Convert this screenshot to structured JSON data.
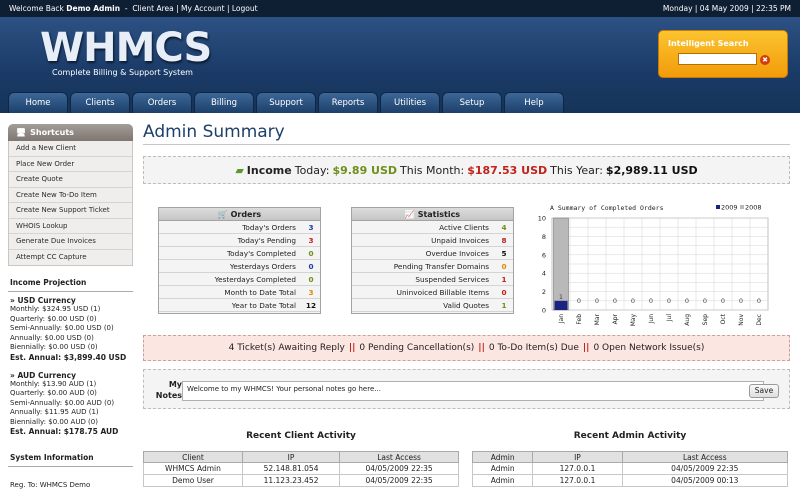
{
  "topbar": {
    "welcome_prefix": "Welcome Back",
    "user": "Demo Admin",
    "links": [
      "Client Area",
      "My Account",
      "Logout"
    ],
    "date": "Monday | 04 May 2009 | 22:35 PM"
  },
  "brand": {
    "logo": "WHMCS",
    "tagline": "Complete Billing & Support System"
  },
  "search": {
    "label": "Intelligent Search",
    "value": ""
  },
  "nav": [
    "Home",
    "Clients",
    "Orders",
    "Billing",
    "Support",
    "Reports",
    "Utilities",
    "Setup",
    "Help"
  ],
  "shortcuts": {
    "title": "Shortcuts",
    "items": [
      "Add a New Client",
      "Place New Order",
      "Create Quote",
      "Create New To-Do Item",
      "Create New Support Ticket",
      "WHOIS Lookup",
      "Generate Due Invoices",
      "Attempt CC Capture"
    ]
  },
  "income_projection": {
    "title": "Income Projection",
    "currencies": [
      {
        "name": "USD Currency",
        "lines": [
          "Monthly: $324.95 USD (1)",
          "Quarterly: $0.00 USD (0)",
          "Semi-Annually: $0.00 USD (0)",
          "Annually: $0.00 USD (0)",
          "Biennially: $0.00 USD (0)"
        ],
        "est": "Est. Annual: $3,899.40 USD"
      },
      {
        "name": "AUD Currency",
        "lines": [
          "Monthly: $13.90 AUD (1)",
          "Quarterly: $0.00 AUD (0)",
          "Semi-Annually: $0.00 AUD (0)",
          "Annually: $11.95 AUD (1)",
          "Biennially: $0.00 AUD (0)"
        ],
        "est": "Est. Annual: $178.75 AUD"
      }
    ]
  },
  "system_info": {
    "title": "System Information",
    "reg_to": "Reg. To: WHMCS Demo"
  },
  "page_title": "Admin Summary",
  "income": {
    "label": "Income",
    "today_label": "Today:",
    "today": "$9.89 USD",
    "month_label": "This Month:",
    "month": "$187.53 USD",
    "year_label": "This Year:",
    "year": "$2,989.11 USD",
    "colors": {
      "today": "#6e8f1b",
      "month": "#c0221c",
      "year": "#111111"
    }
  },
  "orders": {
    "title": "Orders",
    "rows": [
      {
        "label": "Today's Orders",
        "value": "3",
        "color": "#1f3ea0"
      },
      {
        "label": "Today's Pending",
        "value": "3",
        "color": "#c0221c"
      },
      {
        "label": "Today's Completed",
        "value": "0",
        "color": "#6e8f1b"
      },
      {
        "label": "Yesterdays Orders",
        "value": "0",
        "color": "#1f3ea0"
      },
      {
        "label": "Yesterdays Completed",
        "value": "0",
        "color": "#6e8f1b"
      },
      {
        "label": "Month to Date Total",
        "value": "3",
        "color": "#e08a00"
      },
      {
        "label": "Year to Date Total",
        "value": "12",
        "color": "#111111"
      }
    ]
  },
  "statistics": {
    "title": "Statistics",
    "rows": [
      {
        "label": "Active Clients",
        "value": "4",
        "color": "#6e8f1b"
      },
      {
        "label": "Unpaid Invoices",
        "value": "8",
        "color": "#c0221c"
      },
      {
        "label": "Overdue Invoices",
        "value": "5",
        "color": "#111111"
      },
      {
        "label": "Pending Transfer Domains",
        "value": "0",
        "color": "#e08a00"
      },
      {
        "label": "Suspended Services",
        "value": "1",
        "color": "#c0221c"
      },
      {
        "label": "Uninvoiced Billable Items",
        "value": "0",
        "color": "#c0221c"
      },
      {
        "label": "Valid Quotes",
        "value": "1",
        "color": "#6e8f1b"
      }
    ]
  },
  "chart_data": {
    "type": "bar",
    "title": "A Summary of Completed Orders",
    "categories": [
      "Jan",
      "Feb",
      "Mar",
      "Apr",
      "May",
      "Jun",
      "Jul",
      "Aug",
      "Sep",
      "Oct",
      "Nov",
      "Dec"
    ],
    "series": [
      {
        "name": "2009",
        "color": "#1a237e",
        "values": [
          1,
          0,
          0,
          0,
          0,
          0,
          0,
          0,
          0,
          0,
          0,
          0
        ]
      },
      {
        "name": "2008",
        "color": "#b9b9b9",
        "values": [
          10,
          0,
          0,
          0,
          0,
          0,
          0,
          0,
          0,
          0,
          0,
          0
        ]
      }
    ],
    "bar_labels": [
      "1",
      "0",
      "0",
      "0",
      "0",
      "0",
      "0",
      "0",
      "0",
      "0",
      "0",
      "0"
    ],
    "yticks": [
      0,
      2,
      4,
      6,
      8,
      10
    ],
    "ylim": [
      0,
      10
    ],
    "grid": true,
    "legend": "top-right"
  },
  "tickets": {
    "parts": [
      "4 Ticket(s) Awaiting Reply",
      "0 Pending Cancellation(s)",
      "0 To-Do Item(s) Due",
      "0 Open Network Issue(s)"
    ],
    "separator": "||"
  },
  "notes": {
    "label": "My Notes",
    "text": "Welcome to my WHMCS! Your personal notes go here...",
    "save": "Save"
  },
  "client_activity": {
    "title": "Recent Client Activity",
    "headers": [
      "Client",
      "IP",
      "Last Access"
    ],
    "rows": [
      [
        "WHMCS Admin",
        "52.148.81.054",
        "04/05/2009 22:35"
      ],
      [
        "Demo User",
        "11.123.23.452",
        "04/05/2009 22:35"
      ]
    ]
  },
  "admin_activity": {
    "title": "Recent Admin Activity",
    "headers": [
      "Admin",
      "IP",
      "Last Access"
    ],
    "rows": [
      [
        "Admin",
        "127.0.0.1",
        "04/05/2009 22:35"
      ],
      [
        "Admin",
        "127.0.0.1",
        "04/05/2009 00:13"
      ]
    ]
  }
}
